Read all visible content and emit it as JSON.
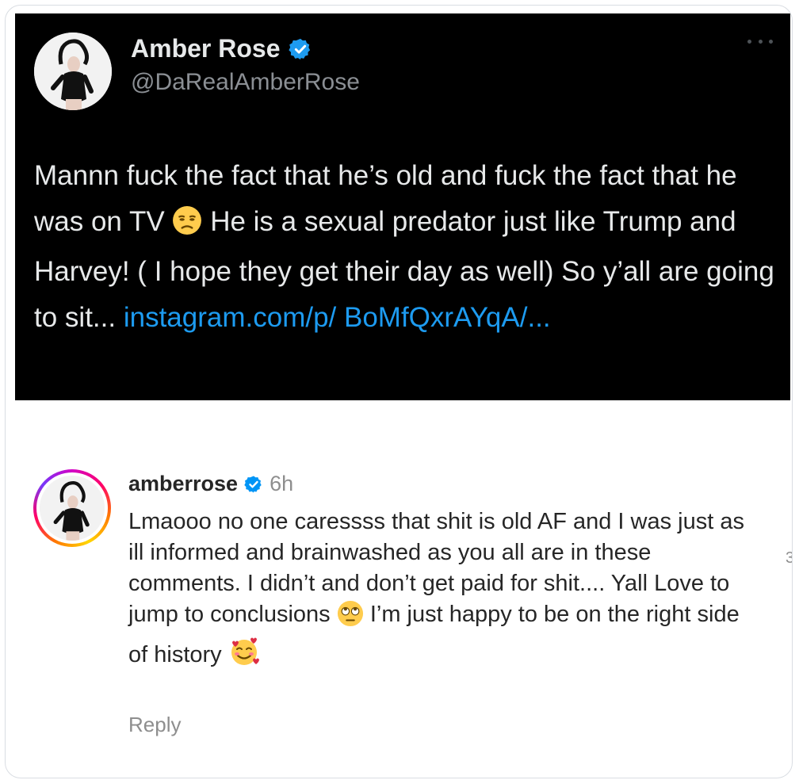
{
  "tweet": {
    "display_name": "Amber Rose",
    "handle": "@DaRealAmberRose",
    "text_part1": "Mannn fuck the fact that he’s old and fuck the fact that he was on TV",
    "text_emoji": "unamused-face",
    "text_part2": "He is a sexual predator just like Trump and Harvey! ( I hope they get their day as well) So y’all are going to sit...",
    "link": "instagram.com/p/ BoMfQxrAYqA/...",
    "more_icon": "more-horizontal-icon",
    "colors": {
      "background": "#000000",
      "text": "#e7e9ea",
      "handle": "#8b8f94",
      "link": "#1d9bf0",
      "verified": "#1d9bf0"
    }
  },
  "comment": {
    "username": "amberrose",
    "time": "6h",
    "text_part1": "Lmaooo no one caressss that shit is old AF and I was just as ill informed and brainwashed as you all are in these comments. I didn’t and don’t get paid for shit.... Yall Love to jump to conclusions",
    "emoji_1": "face-with-rolling-eyes",
    "text_part2": "I’m just happy to be on the right side of history",
    "emoji_2": "smiling-face-with-hearts",
    "reply_label": "Reply",
    "side_glyph": "3",
    "colors": {
      "text": "#262626",
      "muted": "#8e8e8e",
      "verified": "#0095f6"
    }
  }
}
